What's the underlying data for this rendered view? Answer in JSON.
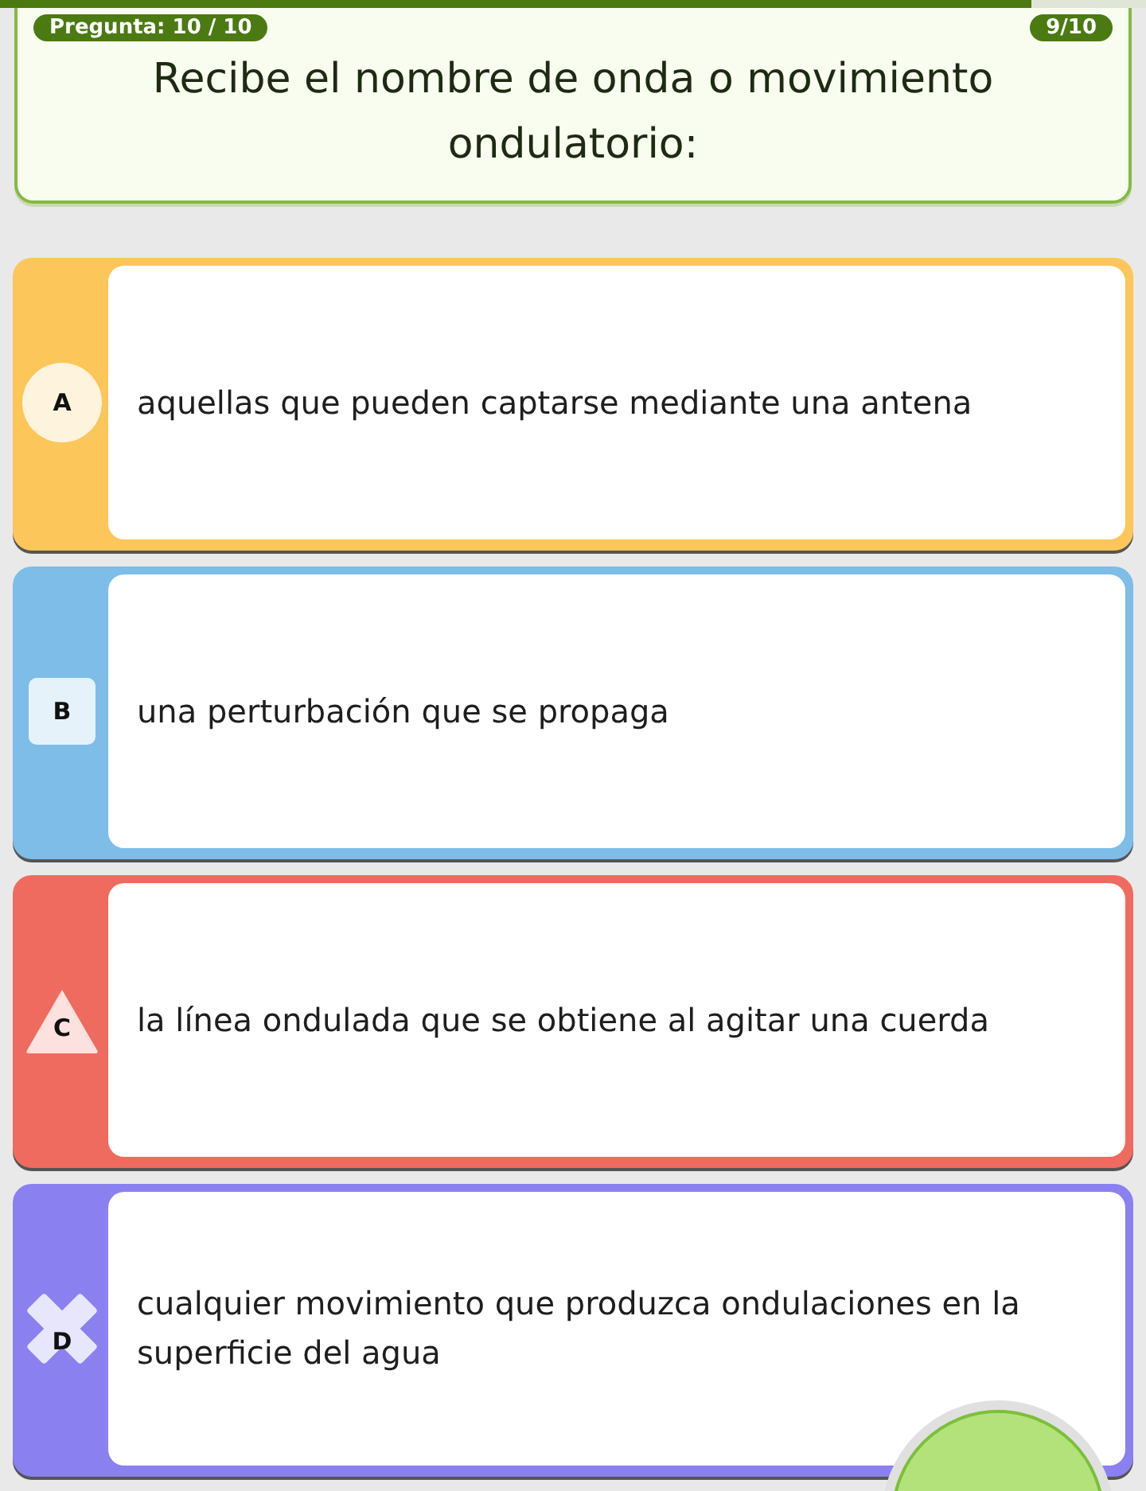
{
  "progress": {
    "level": 0.9
  },
  "question": {
    "counter": "Pregunta: 10 / 10",
    "score": "9/10",
    "text": "Recibe el nombre de onda o movimiento ondulatorio:"
  },
  "options": [
    {
      "letter": "A",
      "kind": "circle",
      "color": "#fcc65a",
      "text": "aquellas que pueden captarse mediante una antena"
    },
    {
      "letter": "B",
      "kind": "square",
      "color": "#7dbde8",
      "text": "una perturbación que se propaga"
    },
    {
      "letter": "C",
      "kind": "triangle",
      "color": "#ef6b5f",
      "text": "la línea ondulada que se obtiene al agitar una cuerda"
    },
    {
      "letter": "D",
      "kind": "cross",
      "color": "#8b80f0",
      "text": "cualquier movimiento que produzca ondulaciones en la superficie del agua"
    }
  ]
}
